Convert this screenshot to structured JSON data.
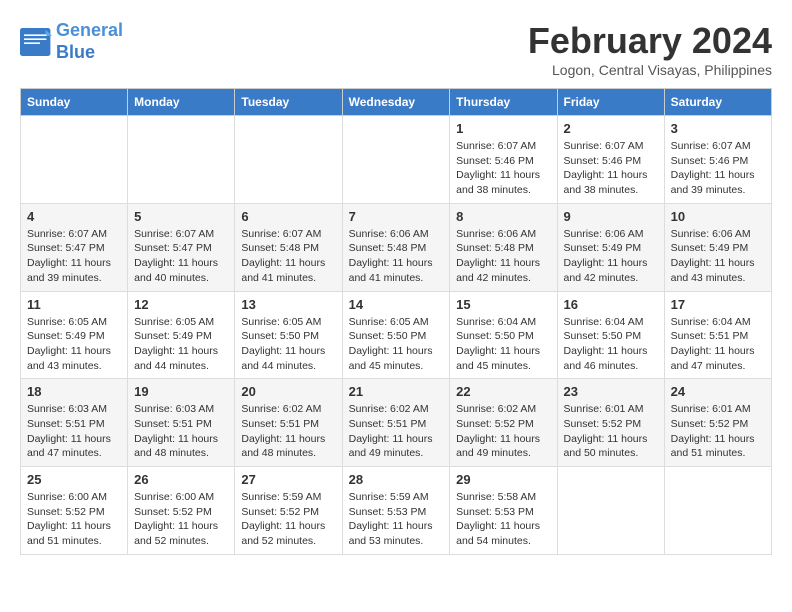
{
  "logo": {
    "line1": "General",
    "line2": "Blue"
  },
  "title": "February 2024",
  "subtitle": "Logon, Central Visayas, Philippines",
  "header": {
    "days": [
      "Sunday",
      "Monday",
      "Tuesday",
      "Wednesday",
      "Thursday",
      "Friday",
      "Saturday"
    ]
  },
  "weeks": [
    [
      {
        "day": "",
        "info": ""
      },
      {
        "day": "",
        "info": ""
      },
      {
        "day": "",
        "info": ""
      },
      {
        "day": "",
        "info": ""
      },
      {
        "day": "1",
        "info": "Sunrise: 6:07 AM\nSunset: 5:46 PM\nDaylight: 11 hours and 38 minutes."
      },
      {
        "day": "2",
        "info": "Sunrise: 6:07 AM\nSunset: 5:46 PM\nDaylight: 11 hours and 38 minutes."
      },
      {
        "day": "3",
        "info": "Sunrise: 6:07 AM\nSunset: 5:46 PM\nDaylight: 11 hours and 39 minutes."
      }
    ],
    [
      {
        "day": "4",
        "info": "Sunrise: 6:07 AM\nSunset: 5:47 PM\nDaylight: 11 hours and 39 minutes."
      },
      {
        "day": "5",
        "info": "Sunrise: 6:07 AM\nSunset: 5:47 PM\nDaylight: 11 hours and 40 minutes."
      },
      {
        "day": "6",
        "info": "Sunrise: 6:07 AM\nSunset: 5:48 PM\nDaylight: 11 hours and 41 minutes."
      },
      {
        "day": "7",
        "info": "Sunrise: 6:06 AM\nSunset: 5:48 PM\nDaylight: 11 hours and 41 minutes."
      },
      {
        "day": "8",
        "info": "Sunrise: 6:06 AM\nSunset: 5:48 PM\nDaylight: 11 hours and 42 minutes."
      },
      {
        "day": "9",
        "info": "Sunrise: 6:06 AM\nSunset: 5:49 PM\nDaylight: 11 hours and 42 minutes."
      },
      {
        "day": "10",
        "info": "Sunrise: 6:06 AM\nSunset: 5:49 PM\nDaylight: 11 hours and 43 minutes."
      }
    ],
    [
      {
        "day": "11",
        "info": "Sunrise: 6:05 AM\nSunset: 5:49 PM\nDaylight: 11 hours and 43 minutes."
      },
      {
        "day": "12",
        "info": "Sunrise: 6:05 AM\nSunset: 5:49 PM\nDaylight: 11 hours and 44 minutes."
      },
      {
        "day": "13",
        "info": "Sunrise: 6:05 AM\nSunset: 5:50 PM\nDaylight: 11 hours and 44 minutes."
      },
      {
        "day": "14",
        "info": "Sunrise: 6:05 AM\nSunset: 5:50 PM\nDaylight: 11 hours and 45 minutes."
      },
      {
        "day": "15",
        "info": "Sunrise: 6:04 AM\nSunset: 5:50 PM\nDaylight: 11 hours and 45 minutes."
      },
      {
        "day": "16",
        "info": "Sunrise: 6:04 AM\nSunset: 5:50 PM\nDaylight: 11 hours and 46 minutes."
      },
      {
        "day": "17",
        "info": "Sunrise: 6:04 AM\nSunset: 5:51 PM\nDaylight: 11 hours and 47 minutes."
      }
    ],
    [
      {
        "day": "18",
        "info": "Sunrise: 6:03 AM\nSunset: 5:51 PM\nDaylight: 11 hours and 47 minutes."
      },
      {
        "day": "19",
        "info": "Sunrise: 6:03 AM\nSunset: 5:51 PM\nDaylight: 11 hours and 48 minutes."
      },
      {
        "day": "20",
        "info": "Sunrise: 6:02 AM\nSunset: 5:51 PM\nDaylight: 11 hours and 48 minutes."
      },
      {
        "day": "21",
        "info": "Sunrise: 6:02 AM\nSunset: 5:51 PM\nDaylight: 11 hours and 49 minutes."
      },
      {
        "day": "22",
        "info": "Sunrise: 6:02 AM\nSunset: 5:52 PM\nDaylight: 11 hours and 49 minutes."
      },
      {
        "day": "23",
        "info": "Sunrise: 6:01 AM\nSunset: 5:52 PM\nDaylight: 11 hours and 50 minutes."
      },
      {
        "day": "24",
        "info": "Sunrise: 6:01 AM\nSunset: 5:52 PM\nDaylight: 11 hours and 51 minutes."
      }
    ],
    [
      {
        "day": "25",
        "info": "Sunrise: 6:00 AM\nSunset: 5:52 PM\nDaylight: 11 hours and 51 minutes."
      },
      {
        "day": "26",
        "info": "Sunrise: 6:00 AM\nSunset: 5:52 PM\nDaylight: 11 hours and 52 minutes."
      },
      {
        "day": "27",
        "info": "Sunrise: 5:59 AM\nSunset: 5:52 PM\nDaylight: 11 hours and 52 minutes."
      },
      {
        "day": "28",
        "info": "Sunrise: 5:59 AM\nSunset: 5:53 PM\nDaylight: 11 hours and 53 minutes."
      },
      {
        "day": "29",
        "info": "Sunrise: 5:58 AM\nSunset: 5:53 PM\nDaylight: 11 hours and 54 minutes."
      },
      {
        "day": "",
        "info": ""
      },
      {
        "day": "",
        "info": ""
      }
    ]
  ]
}
